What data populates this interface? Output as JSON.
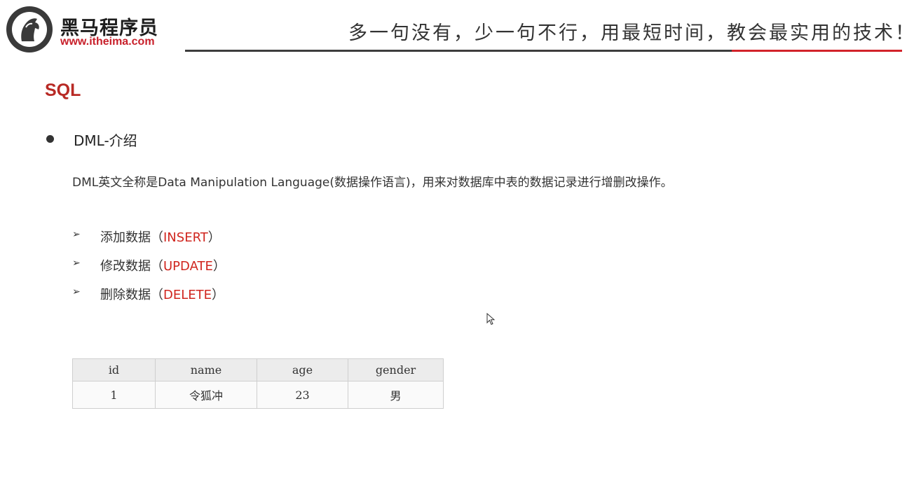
{
  "header": {
    "brand_name": "黑马程序员",
    "brand_url": "www.itheima.com",
    "slogan": "多一句没有，少一句不行，用最短时间，教会最实用的技术！",
    "logo_icon": "horse-head-icon"
  },
  "colors": {
    "accent_red": "#d2232a",
    "title_red": "#b82a25",
    "rule_dark": "#3d3d3d"
  },
  "slide": {
    "title": "SQL",
    "bullet": "DML-介绍",
    "intro": "DML英文全称是Data Manipulation Language(数据操作语言)，用来对数据库中表的数据记录进行增删改操作。",
    "operations": [
      {
        "prefix": "添加数据（",
        "keyword": "INSERT",
        "suffix": "）"
      },
      {
        "prefix": "修改数据（",
        "keyword": "UPDATE",
        "suffix": "）"
      },
      {
        "prefix": "删除数据（",
        "keyword": "DELETE",
        "suffix": "）"
      }
    ]
  },
  "table": {
    "headers": [
      "id",
      "name",
      "age",
      "gender"
    ],
    "rows": [
      [
        "1",
        "令狐冲",
        "23",
        "男"
      ]
    ]
  }
}
